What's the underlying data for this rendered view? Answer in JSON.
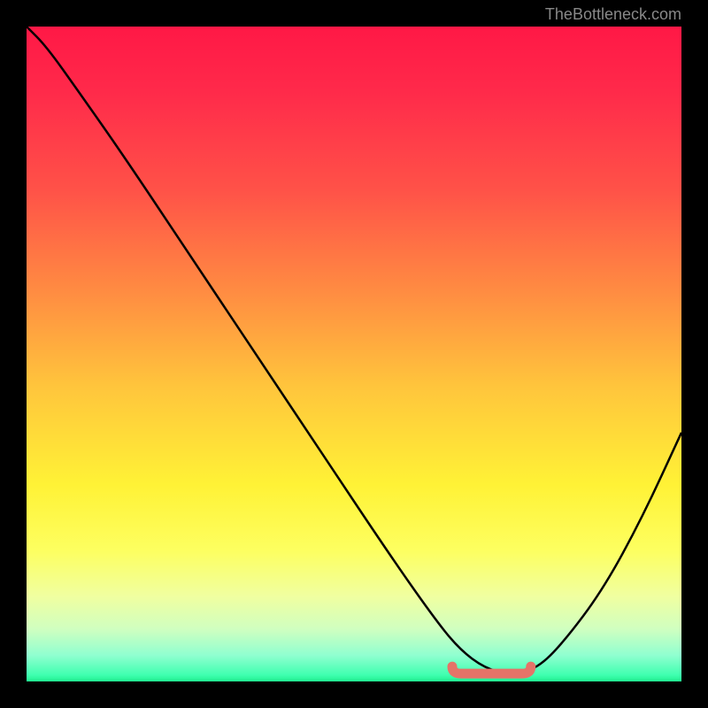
{
  "watermark": "TheBottleneck.com",
  "chart_data": {
    "type": "line",
    "title": "",
    "xlabel": "",
    "ylabel": "",
    "x_range": [
      0,
      100
    ],
    "y_range": [
      0,
      100
    ],
    "series": [
      {
        "name": "bottleneck-curve",
        "x": [
          0,
          3,
          8,
          15,
          25,
          35,
          45,
          55,
          62,
          66,
          70,
          74,
          78,
          82,
          88,
          94,
          100
        ],
        "values": [
          100,
          97,
          90,
          80,
          65,
          50,
          35,
          20,
          10,
          5,
          2,
          1,
          2,
          6,
          14,
          25,
          38
        ]
      }
    ],
    "optimal_range": {
      "x_start": 65,
      "x_end": 77,
      "y": 1.2
    },
    "background_gradient": {
      "top_color": "#ff1846",
      "mid_color": "#ffe136",
      "bottom_color": "#20f090"
    }
  }
}
